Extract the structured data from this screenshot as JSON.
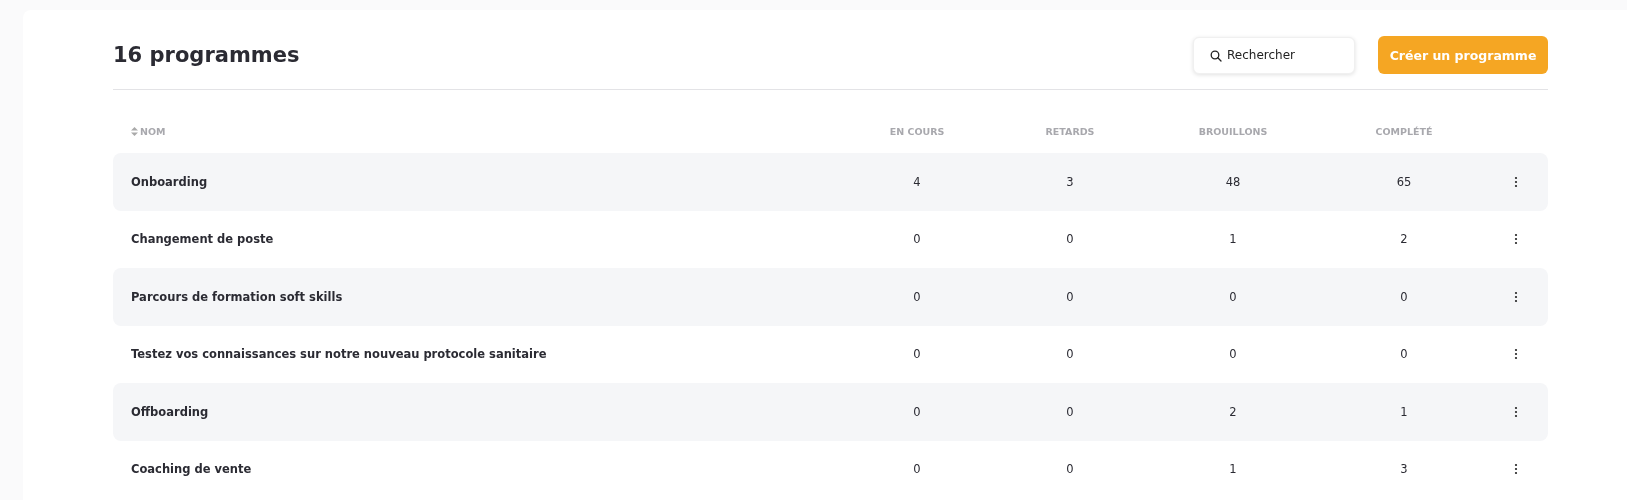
{
  "title": "16 programmes",
  "search": {
    "placeholder": "Rechercher"
  },
  "create_button": "Créer un programme",
  "table": {
    "columns": [
      "NOM",
      "EN COURS",
      "RETARDS",
      "BROUILLONS",
      "COMPLÉTÉ"
    ],
    "rows": [
      {
        "name": "Onboarding",
        "en_cours": "4",
        "retards": "3",
        "brouillons": "48",
        "complete": "65"
      },
      {
        "name": "Changement de poste",
        "en_cours": "0",
        "retards": "0",
        "brouillons": "1",
        "complete": "2"
      },
      {
        "name": "Parcours de formation soft skills",
        "en_cours": "0",
        "retards": "0",
        "brouillons": "0",
        "complete": "0"
      },
      {
        "name": "Testez vos connaissances sur notre nouveau protocole sanitaire",
        "en_cours": "0",
        "retards": "0",
        "brouillons": "0",
        "complete": "0"
      },
      {
        "name": "Offboarding",
        "en_cours": "0",
        "retards": "0",
        "brouillons": "2",
        "complete": "1"
      },
      {
        "name": "Coaching de vente",
        "en_cours": "0",
        "retards": "0",
        "brouillons": "1",
        "complete": "3"
      }
    ]
  }
}
